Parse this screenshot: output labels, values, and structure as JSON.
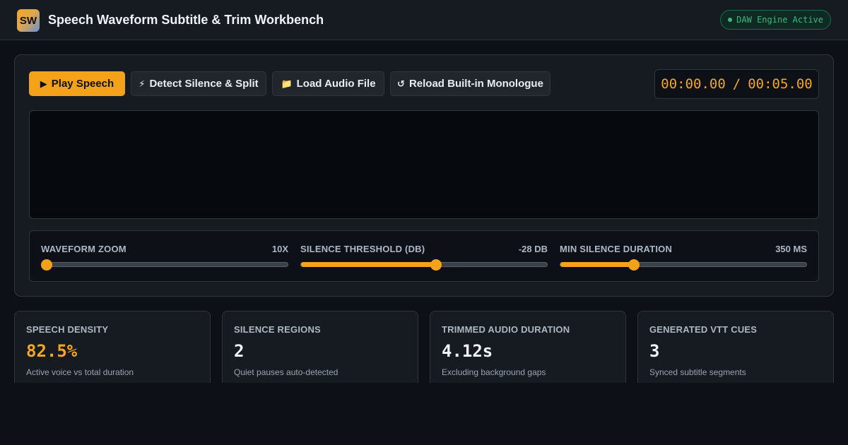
{
  "app": {
    "logo_text": "SW",
    "title": "Speech Waveform Subtitle & Trim Workbench",
    "engine_status": "DAW Engine Active",
    "accent_color": "#f5a21b",
    "status_color": "#3fb67f"
  },
  "toolbar": {
    "play": {
      "icon": "▶",
      "label": "Play Speech"
    },
    "detect": {
      "icon": "⚡",
      "label": "Detect Silence & Split"
    },
    "load": {
      "icon": "📁",
      "label": "Load Audio File"
    },
    "reload": {
      "icon": "↺",
      "label": "Reload Built-in Monologue"
    }
  },
  "timer": {
    "current": "00:00.00",
    "separator": "/",
    "total": "00:05.00"
  },
  "controls": [
    {
      "label": "Waveform Zoom",
      "value": "10x",
      "fraction": 0.0
    },
    {
      "label": "Silence Threshold (dB)",
      "value": "-28 dB",
      "fraction": 0.55
    },
    {
      "label": "Min Silence Duration",
      "value": "350 ms",
      "fraction": 0.29
    }
  ],
  "stats": [
    {
      "label": "Speech Density",
      "value": "82.5%",
      "sub": "Active voice vs total duration",
      "accent": true
    },
    {
      "label": "Silence Regions",
      "value": "2",
      "sub": "Quiet pauses auto-detected",
      "accent": false
    },
    {
      "label": "Trimmed Audio Duration",
      "value": "4.12s",
      "sub": "Excluding background gaps",
      "accent": false
    },
    {
      "label": "Generated VTT Cues",
      "value": "3",
      "sub": "Synced subtitle segments",
      "accent": false
    }
  ]
}
